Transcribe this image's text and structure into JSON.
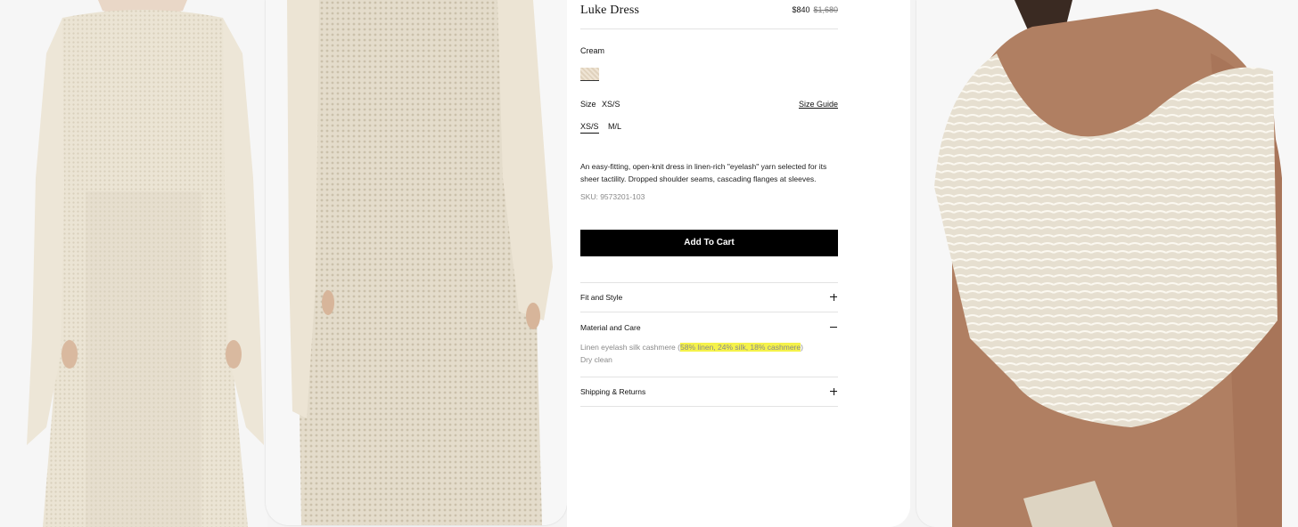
{
  "product": {
    "name": "Luke Dress",
    "price": "$840",
    "original_price": "$1,680",
    "color_label": "Cream",
    "size_label": "Size",
    "selected_size": "XS/S",
    "size_guide": "Size Guide",
    "sizes": [
      "XS/S",
      "M/L"
    ],
    "description": "An easy-fitting, open-knit dress in linen-rich \"eyelash\" yarn selected for its sheer tactility. Dropped shoulder seams, cascading flanges at sleeves.",
    "sku": "SKU: 9573201-103",
    "add_to_cart": "Add To Cart"
  },
  "accordion": {
    "fit": {
      "title": "Fit and Style",
      "state": "collapsed"
    },
    "material": {
      "title": "Material and Care",
      "state": "expanded",
      "line1_prefix": "Linen eyelash silk cashmere (",
      "line1_highlight": "58% linen, 24% silk, 18% cashmere",
      "line1_suffix": ")",
      "line2": "Dry clean"
    },
    "shipping": {
      "title": "Shipping & Returns",
      "state": "collapsed"
    }
  },
  "colors": {
    "highlight": "#f5f24a",
    "button": "#000000",
    "swatch": "#e5d8c6"
  }
}
